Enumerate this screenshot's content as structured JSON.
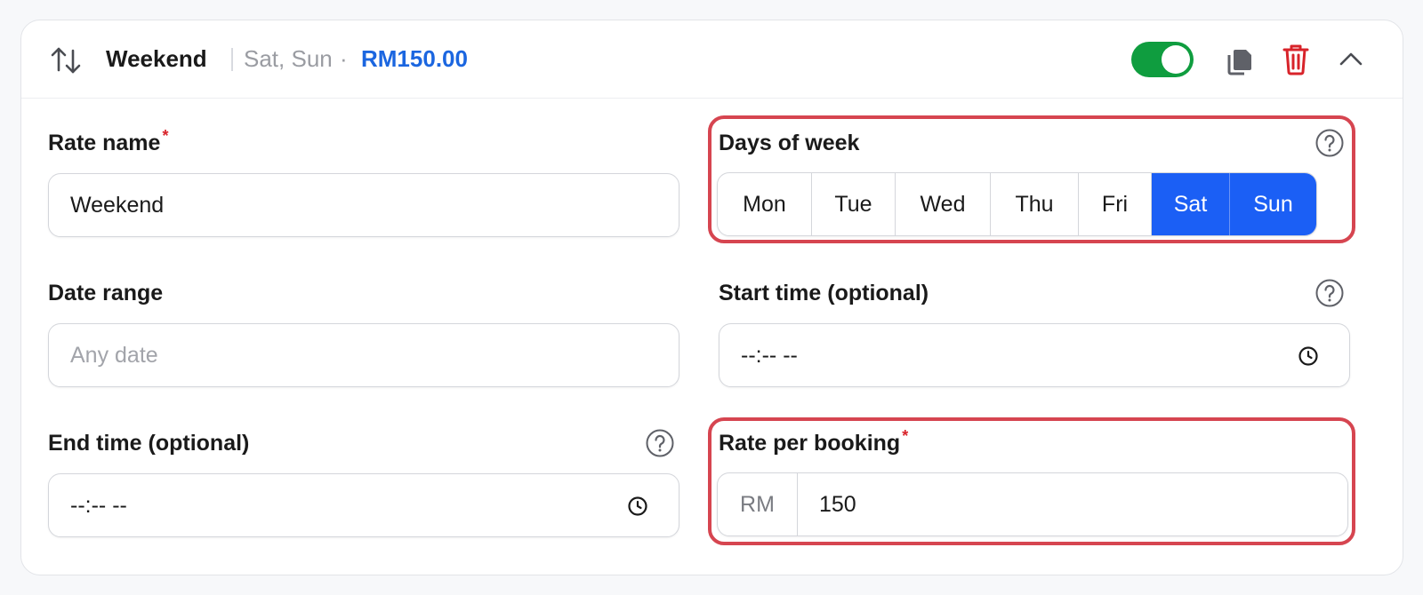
{
  "header": {
    "title": "Weekend",
    "days_summary": "Sat, Sun",
    "separator": "·",
    "price": "RM150.00",
    "enabled": true
  },
  "form": {
    "rate_name": {
      "label": "Rate name",
      "required_mark": "*",
      "value": "Weekend"
    },
    "days_of_week": {
      "label": "Days of week",
      "days": [
        {
          "label": "Mon",
          "selected": false
        },
        {
          "label": "Tue",
          "selected": false
        },
        {
          "label": "Wed",
          "selected": false
        },
        {
          "label": "Thu",
          "selected": false
        },
        {
          "label": "Fri",
          "selected": false
        },
        {
          "label": "Sat",
          "selected": true
        },
        {
          "label": "Sun",
          "selected": true
        }
      ]
    },
    "date_range": {
      "label": "Date range",
      "placeholder": "Any date"
    },
    "start_time": {
      "label": "Start time (optional)",
      "value": "--:-- --"
    },
    "end_time": {
      "label": "End time (optional)",
      "value": "--:-- --"
    },
    "rate_per_booking": {
      "label": "Rate per booking",
      "required_mark": "*",
      "prefix": "RM",
      "value": "150"
    }
  },
  "colors": {
    "accent": "#1b5ff5",
    "price": "#1b66e0",
    "toggle_on": "#0f9d3f",
    "delete": "#d8232a",
    "highlight": "#d64550"
  },
  "icons": {
    "sort": "sort-arrows-icon",
    "copy": "copy-icon",
    "delete": "trash-icon",
    "collapse": "chevron-up-icon",
    "help": "help-circle-icon",
    "time": "clock-icon"
  }
}
